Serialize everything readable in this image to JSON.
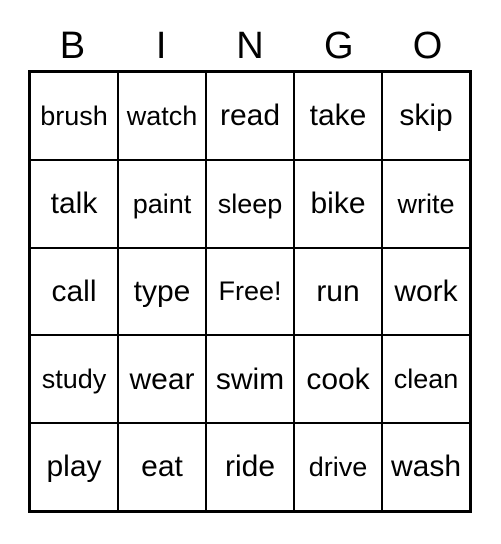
{
  "card": {
    "type": "bingo-card",
    "columns": 5,
    "rows": 5,
    "background_color": "#ffffff",
    "border_color": "#000000",
    "text_color": "#000000"
  },
  "header": {
    "letters": [
      "B",
      "I",
      "N",
      "G",
      "O"
    ]
  },
  "grid": {
    "free_space_label": "Free!",
    "free_space_position": {
      "row": 2,
      "col": 2
    },
    "rows": [
      [
        "brush",
        "watch",
        "read",
        "take",
        "skip"
      ],
      [
        "talk",
        "paint",
        "sleep",
        "bike",
        "write"
      ],
      [
        "call",
        "type",
        "Free!",
        "run",
        "work"
      ],
      [
        "study",
        "wear",
        "swim",
        "cook",
        "clean"
      ],
      [
        "play",
        "eat",
        "ride",
        "drive",
        "wash"
      ]
    ]
  }
}
